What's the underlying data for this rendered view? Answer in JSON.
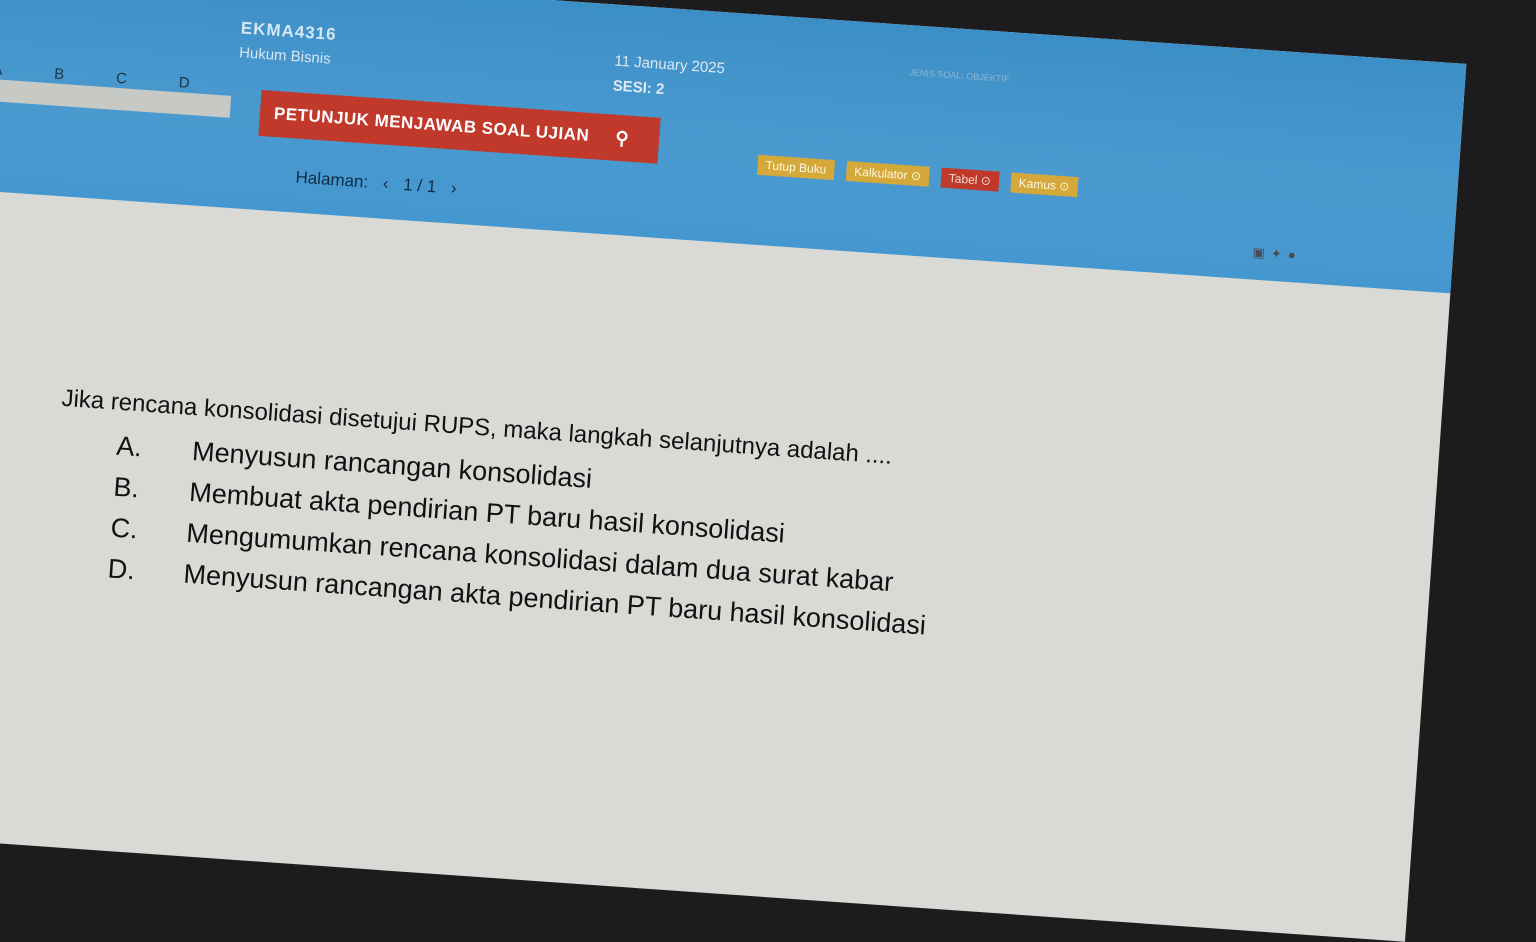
{
  "course": {
    "code": "EKMA4316",
    "name": "Hukum Bisnis"
  },
  "answer_letters": [
    "A",
    "B",
    "C",
    "D"
  ],
  "instruction_button": "PETUNJUK MENJAWAB SOAL UJIAN",
  "date": "11 January 2025",
  "session": "SESI: 2",
  "paging": {
    "label": "Halaman:",
    "prev": "‹",
    "value": "1 / 1",
    "next": "›"
  },
  "meta_lines": [
    "JENIS SOAL: OBJEKTIF"
  ],
  "tools": [
    "Tutup Buku",
    "Kalkulator ⊙",
    "Tabel ⊙",
    "Kamus ⊙"
  ],
  "question": "Jika rencana konsolidasi disetujui RUPS, maka langkah selanjutnya adalah ....",
  "options": [
    {
      "letter": "A.",
      "text": "Menyusun rancangan konsolidasi"
    },
    {
      "letter": "B.",
      "text": "Membuat akta pendirian PT baru hasil konsolidasi"
    },
    {
      "letter": "C.",
      "text": "Mengumumkan rencana konsolidasi dalam dua surat kabar"
    },
    {
      "letter": "D.",
      "text": "Menyusun rancangan akta pendirian PT baru hasil konsolidasi"
    }
  ]
}
